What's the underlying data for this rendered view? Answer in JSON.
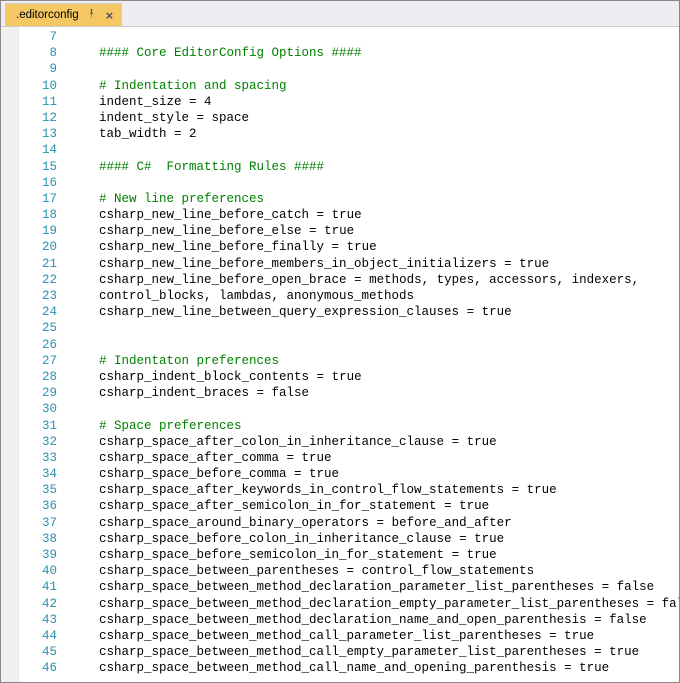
{
  "tab": {
    "title": ".editorconfig",
    "pin_glyph": "📌",
    "close_glyph": "×"
  },
  "lines": [
    {
      "num": 7,
      "tokens": []
    },
    {
      "num": 8,
      "tokens": [
        {
          "t": "#### Core EditorConfig Options ####",
          "c": "comment"
        }
      ]
    },
    {
      "num": 9,
      "tokens": []
    },
    {
      "num": 10,
      "tokens": [
        {
          "t": "# Indentation and spacing",
          "c": "comment"
        }
      ]
    },
    {
      "num": 11,
      "tokens": [
        {
          "t": "indent_size",
          "c": "identifier"
        },
        {
          "t": " = ",
          "c": "value"
        },
        {
          "t": "4",
          "c": "value"
        }
      ]
    },
    {
      "num": 12,
      "tokens": [
        {
          "t": "indent_style",
          "c": "identifier"
        },
        {
          "t": " = ",
          "c": "value"
        },
        {
          "t": "space",
          "c": "value"
        }
      ]
    },
    {
      "num": 13,
      "tokens": [
        {
          "t": "tab_width",
          "c": "identifier"
        },
        {
          "t": " = ",
          "c": "value"
        },
        {
          "t": "2",
          "c": "value"
        }
      ]
    },
    {
      "num": 14,
      "tokens": []
    },
    {
      "num": 15,
      "tokens": [
        {
          "t": "#### C#  Formatting Rules ####",
          "c": "comment"
        }
      ]
    },
    {
      "num": 16,
      "tokens": []
    },
    {
      "num": 17,
      "tokens": [
        {
          "t": "# New line preferences",
          "c": "comment"
        }
      ]
    },
    {
      "num": 18,
      "tokens": [
        {
          "t": "csharp_new_line_before_catch",
          "c": "identifier"
        },
        {
          "t": " = ",
          "c": "value"
        },
        {
          "t": "true",
          "c": "value"
        }
      ]
    },
    {
      "num": 19,
      "tokens": [
        {
          "t": "csharp_new_line_before_else",
          "c": "identifier"
        },
        {
          "t": " = ",
          "c": "value"
        },
        {
          "t": "true",
          "c": "value"
        }
      ]
    },
    {
      "num": 20,
      "tokens": [
        {
          "t": "csharp_new_line_before_finally",
          "c": "identifier"
        },
        {
          "t": " = ",
          "c": "value"
        },
        {
          "t": "true",
          "c": "value"
        }
      ]
    },
    {
      "num": 21,
      "tokens": [
        {
          "t": "csharp_new_line_before_members_in_object_initializers",
          "c": "identifier"
        },
        {
          "t": " = ",
          "c": "value"
        },
        {
          "t": "true",
          "c": "value"
        }
      ]
    },
    {
      "num": 22,
      "tokens": [
        {
          "t": "csharp_new_line_before_open_brace",
          "c": "identifier"
        },
        {
          "t": " = ",
          "c": "value"
        },
        {
          "t": "methods, types, accessors, indexers,",
          "c": "value"
        }
      ]
    },
    {
      "num": 23,
      "tokens": [
        {
          "t": "control_blocks, lambdas, anonymous_methods",
          "c": "value"
        }
      ]
    },
    {
      "num": 24,
      "tokens": [
        {
          "t": "csharp_new_line_between_query_expression_clauses",
          "c": "identifier"
        },
        {
          "t": " = ",
          "c": "value"
        },
        {
          "t": "true",
          "c": "value"
        }
      ]
    },
    {
      "num": 25,
      "tokens": []
    },
    {
      "num": 26,
      "tokens": []
    },
    {
      "num": 27,
      "tokens": [
        {
          "t": "# Indentaton preferences",
          "c": "comment"
        }
      ]
    },
    {
      "num": 28,
      "tokens": [
        {
          "t": "csharp_indent_block_contents",
          "c": "identifier"
        },
        {
          "t": " = ",
          "c": "value"
        },
        {
          "t": "true",
          "c": "value"
        }
      ]
    },
    {
      "num": 29,
      "tokens": [
        {
          "t": "csharp_indent_braces",
          "c": "identifier"
        },
        {
          "t": " = ",
          "c": "value"
        },
        {
          "t": "false",
          "c": "value"
        }
      ]
    },
    {
      "num": 30,
      "tokens": []
    },
    {
      "num": 31,
      "tokens": [
        {
          "t": "# Space preferences",
          "c": "comment"
        }
      ]
    },
    {
      "num": 32,
      "tokens": [
        {
          "t": "csharp_space_after_colon_in_inheritance_clause",
          "c": "identifier"
        },
        {
          "t": " = ",
          "c": "value"
        },
        {
          "t": "true",
          "c": "value"
        }
      ]
    },
    {
      "num": 33,
      "tokens": [
        {
          "t": "csharp_space_after_comma",
          "c": "identifier"
        },
        {
          "t": " = ",
          "c": "value"
        },
        {
          "t": "true",
          "c": "value"
        }
      ]
    },
    {
      "num": 34,
      "tokens": [
        {
          "t": "csharp_space_before_comma",
          "c": "identifier"
        },
        {
          "t": " = ",
          "c": "value"
        },
        {
          "t": "true",
          "c": "value"
        }
      ]
    },
    {
      "num": 35,
      "tokens": [
        {
          "t": "csharp_space_after_keywords_in_control_flow_statements",
          "c": "identifier"
        },
        {
          "t": " = ",
          "c": "value"
        },
        {
          "t": "true",
          "c": "value"
        }
      ]
    },
    {
      "num": 36,
      "tokens": [
        {
          "t": "csharp_space_after_semicolon_in_for_statement",
          "c": "identifier"
        },
        {
          "t": " = ",
          "c": "value"
        },
        {
          "t": "true",
          "c": "value"
        }
      ]
    },
    {
      "num": 37,
      "tokens": [
        {
          "t": "csharp_space_around_binary_operators",
          "c": "identifier"
        },
        {
          "t": " = ",
          "c": "value"
        },
        {
          "t": "before_and_after",
          "c": "value"
        }
      ]
    },
    {
      "num": 38,
      "tokens": [
        {
          "t": "csharp_space_before_colon_in_inheritance_clause",
          "c": "identifier"
        },
        {
          "t": " = ",
          "c": "value"
        },
        {
          "t": "true",
          "c": "value"
        }
      ]
    },
    {
      "num": 39,
      "tokens": [
        {
          "t": "csharp_space_before_semicolon_in_for_statement",
          "c": "identifier"
        },
        {
          "t": " = ",
          "c": "value"
        },
        {
          "t": "true",
          "c": "value"
        }
      ]
    },
    {
      "num": 40,
      "tokens": [
        {
          "t": "csharp_space_between_parentheses",
          "c": "identifier"
        },
        {
          "t": " = ",
          "c": "value"
        },
        {
          "t": "control_flow_statements",
          "c": "value"
        }
      ]
    },
    {
      "num": 41,
      "tokens": [
        {
          "t": "csharp_space_between_method_declaration_parameter_list_parentheses",
          "c": "identifier"
        },
        {
          "t": " = ",
          "c": "value"
        },
        {
          "t": "false",
          "c": "value"
        }
      ]
    },
    {
      "num": 42,
      "tokens": [
        {
          "t": "csharp_space_between_method_declaration_empty_parameter_list_parentheses",
          "c": "identifier"
        },
        {
          "t": " = ",
          "c": "value"
        },
        {
          "t": "false",
          "c": "value"
        }
      ]
    },
    {
      "num": 43,
      "tokens": [
        {
          "t": "csharp_space_between_method_declaration_name_and_open_parenthesis",
          "c": "identifier"
        },
        {
          "t": " = ",
          "c": "value"
        },
        {
          "t": "false",
          "c": "value"
        }
      ]
    },
    {
      "num": 44,
      "tokens": [
        {
          "t": "csharp_space_between_method_call_parameter_list_parentheses",
          "c": "identifier"
        },
        {
          "t": " = ",
          "c": "value"
        },
        {
          "t": "true",
          "c": "value"
        }
      ]
    },
    {
      "num": 45,
      "tokens": [
        {
          "t": "csharp_space_between_method_call_empty_parameter_list_parentheses",
          "c": "identifier"
        },
        {
          "t": " = ",
          "c": "value"
        },
        {
          "t": "true",
          "c": "value"
        }
      ]
    },
    {
      "num": 46,
      "tokens": [
        {
          "t": "csharp_space_between_method_call_name_and_opening_parenthesis",
          "c": "identifier"
        },
        {
          "t": " = ",
          "c": "value"
        },
        {
          "t": "true",
          "c": "value"
        }
      ]
    }
  ]
}
